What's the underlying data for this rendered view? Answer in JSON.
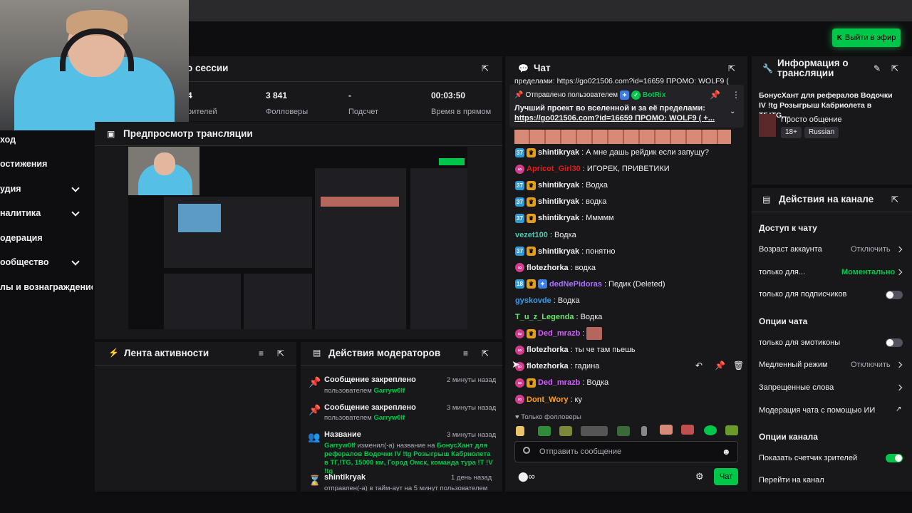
{
  "go_live": {
    "label": "Выйти в эфир"
  },
  "sidebar": {
    "items": [
      {
        "label": "ход",
        "has_chevron": false
      },
      {
        "label": "остижения",
        "has_chevron": false
      },
      {
        "label": "удия",
        "has_chevron": true
      },
      {
        "label": "налитика",
        "has_chevron": true
      },
      {
        "label": "одерация",
        "has_chevron": false
      },
      {
        "label": "ообщество",
        "has_chevron": true
      },
      {
        "label": "лы и вознаграждение",
        "has_chevron": false
      }
    ]
  },
  "session": {
    "title": "о сессии",
    "stats": [
      {
        "value": "4",
        "label": "рителей"
      },
      {
        "value": "3 841",
        "label": "Фолловеры"
      },
      {
        "value": "-",
        "label": "Подсчет"
      },
      {
        "value": "00:03:50",
        "label": "Время в прямом"
      }
    ]
  },
  "preview": {
    "title": "Предпросмотр трансляции"
  },
  "activity": {
    "title": "Лента активности"
  },
  "mod_actions": {
    "title": "Действия модераторов",
    "rows": [
      {
        "icon": "pin-icon",
        "title": "Сообщение закреплено",
        "sub": "пользователем",
        "user": "Garryw0lf",
        "time": "2 минуты назад"
      },
      {
        "icon": "pin-icon",
        "title": "Сообщение закреплено",
        "sub": "пользователем",
        "user": "Garryw0lf",
        "time": "3 минуты назад"
      },
      {
        "icon": "users-icon",
        "title": "Название",
        "user": "Garryw0lf",
        "sub": "изменил(-а) название на",
        "text": "БонусХант для рефералов Водочки IV !tg Розыгрыш Кабриолета в ТГ,!TG, 15000 км, Город Омск, команда тура !T !V !tg",
        "time": "3 минуты назад"
      },
      {
        "icon": "hourglass-icon",
        "title": "shintikryak",
        "sub": "отправлен(-а) в тайм-аут на 5 минут пользователем",
        "time": "1 день назад"
      }
    ]
  },
  "chat": {
    "title": "Чат",
    "top_fragment": "пределами: https://go021506.com?id=16659 ПРОМО: WOLF9 (",
    "pinned": {
      "by_label": "Отправлено пользователем",
      "by_user": "BotRix",
      "text": "Лучший проект во вселенной и за её пределами:",
      "link": "https://go021506.com?id=16659 ПРОМО: WOLF9 ( +..."
    },
    "messages": [
      {
        "badges": [
          "sub:37",
          "crown"
        ],
        "user": "shintikryak",
        "color": "#efeff1",
        "text": "А мне дашь рейдик если запущу?"
      },
      {
        "badges": [
          "pink"
        ],
        "user": "Apricot_Girl30",
        "color": "#e91916",
        "text": "ИГОРЕК, ПРИВЕТИКИ"
      },
      {
        "badges": [
          "sub:37",
          "crown"
        ],
        "user": "shintikryak",
        "color": "#efeff1",
        "text": "Водка"
      },
      {
        "badges": [
          "sub:37",
          "crown"
        ],
        "user": "shintikryak",
        "color": "#efeff1",
        "text": "водка"
      },
      {
        "badges": [
          "sub:37",
          "crown"
        ],
        "user": "shintikryak",
        "color": "#efeff1",
        "text": "Ммммм"
      },
      {
        "badges": [],
        "user": "vezet100",
        "color": "#4ec9b0",
        "text": "Водка"
      },
      {
        "badges": [
          "sub:37",
          "crown"
        ],
        "user": "shintikryak",
        "color": "#efeff1",
        "text": "понятно"
      },
      {
        "badges": [
          "pink"
        ],
        "user": "flotezhorka",
        "color": "#efeff1",
        "text": "водка"
      },
      {
        "badges": [
          "sub:18",
          "crown",
          "blue"
        ],
        "user": "dedNePidoras",
        "color": "#a970ff",
        "text": "Педик (Deleted)"
      },
      {
        "badges": [],
        "user": "gyskovde",
        "color": "#3d9be9",
        "text": "Водка"
      },
      {
        "badges": [],
        "user": "T_u_z_Legenda",
        "color": "#6fe36f",
        "text": "Водка"
      },
      {
        "badges": [
          "pink",
          "crown"
        ],
        "user": "Ded_mrazb",
        "color": "#d45cff",
        "text": "",
        "emote": true
      },
      {
        "badges": [
          "pink"
        ],
        "user": "flotezhorka",
        "color": "#efeff1",
        "text": "ты че там пьешь"
      },
      {
        "badges": [
          "pink"
        ],
        "user": "flotezhorka",
        "color": "#efeff1",
        "text": "гадина"
      },
      {
        "badges": [
          "pink",
          "crown"
        ],
        "user": "Ded_mrazb",
        "color": "#d45cff",
        "text": "Водка"
      },
      {
        "badges": [
          "pink"
        ],
        "user": "Dont_Wory",
        "color": "#ff9f1a",
        "text": "ку"
      }
    ],
    "followers_only": "Только фолловеры",
    "input_placeholder": "Отправить сообщение",
    "send_label": "Чат"
  },
  "stream_info": {
    "title_line1": "Информация о",
    "title_line2": "трансляции",
    "stream_title": "БонусХант для рефералов Водочки IV !tg Розыгрыш Кабриолета в ТГ,!TG,...",
    "category": "Просто общение",
    "tags": [
      "18+",
      "Russian"
    ]
  },
  "channel_actions": {
    "title": "Действия на канале",
    "chat_access": {
      "title": "Доступ к чату",
      "account_age_label": "Возраст аккаунта",
      "account_age_value": "Отключить",
      "followers_only_label": "только для...",
      "followers_only_value": "Моментально",
      "subs_only_label": "только для подписчиков"
    },
    "chat_options": {
      "title": "Опции чата",
      "emote_only_label": "только для эмотиконы",
      "slow_mode_label": "Медленный режим",
      "slow_mode_value": "Отключить",
      "banned_words_label": "Запрещенные слова",
      "ai_mod_label": "Модерация чата с помощью ИИ"
    },
    "channel_options": {
      "title": "Опции канала",
      "viewer_count_label": "Показать счетчик зрителей",
      "go_to_channel_label": "Перейти на канал"
    }
  },
  "colors": {
    "accent": "#00c74a",
    "panel": "#18181b",
    "bg": "#0e0e10"
  }
}
